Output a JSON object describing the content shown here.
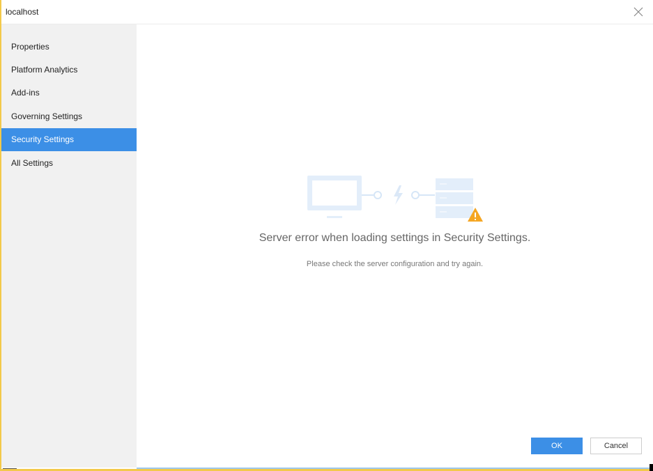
{
  "window": {
    "title": "localhost",
    "close_icon": "close-icon"
  },
  "sidebar": {
    "items": [
      {
        "label": "Properties",
        "active": false
      },
      {
        "label": "Platform Analytics",
        "active": false
      },
      {
        "label": "Add-ins",
        "active": false
      },
      {
        "label": "Governing Settings",
        "active": false
      },
      {
        "label": "Security Settings",
        "active": true
      },
      {
        "label": "All Settings",
        "active": false
      }
    ]
  },
  "main": {
    "illustration": "server-connection-error-illustration",
    "error_title": "Server error when loading settings in Security Settings.",
    "error_detail": "Please check the server configuration and try again."
  },
  "footer": {
    "ok_label": "OK",
    "cancel_label": "Cancel"
  },
  "colors": {
    "accent": "#3c8fe6",
    "sidebar_bg": "#f1f1f1",
    "warning": "#f5a623",
    "illustration": "#e6f0fb"
  }
}
